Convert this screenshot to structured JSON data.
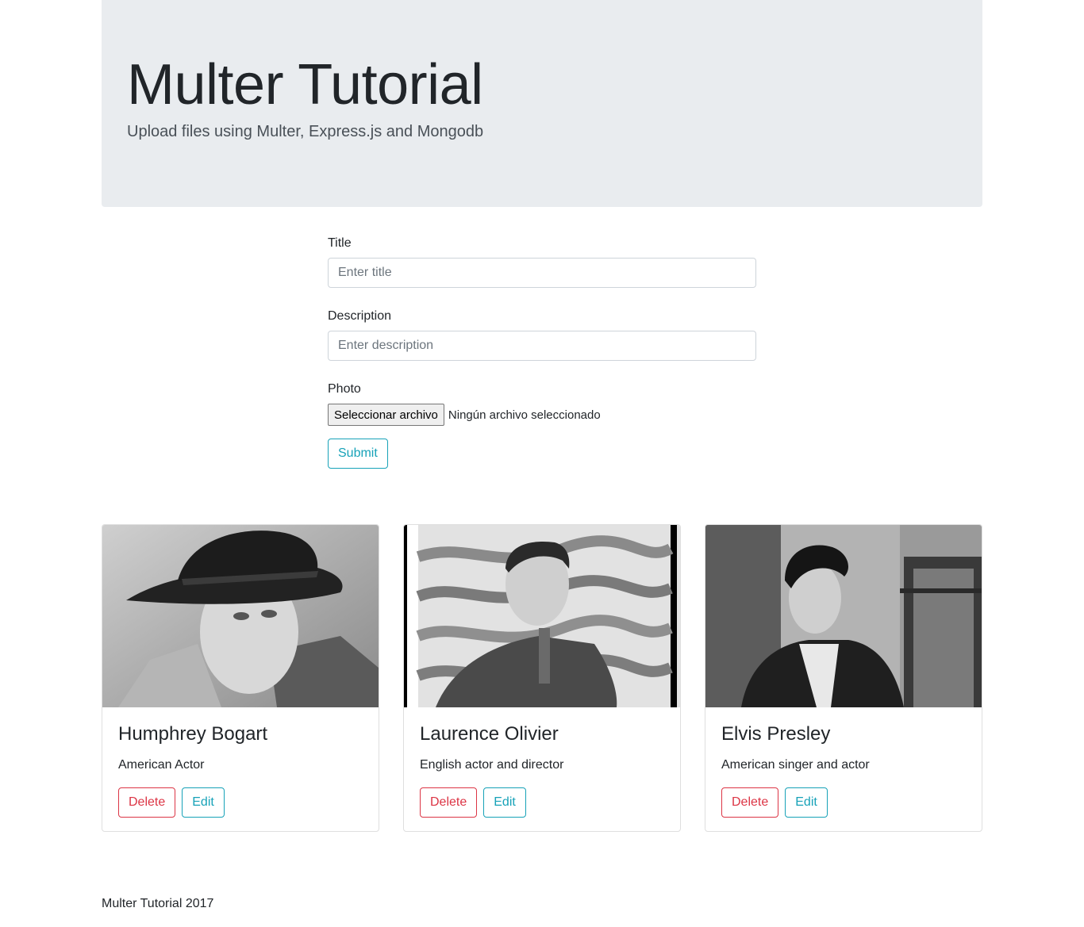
{
  "jumbotron": {
    "title": "Multer Tutorial",
    "subtitle": "Upload files using Multer, Express.js and Mongodb"
  },
  "form": {
    "title_label": "Title",
    "title_placeholder": "Enter title",
    "description_label": "Description",
    "description_placeholder": "Enter description",
    "photo_label": "Photo",
    "file_button": "Seleccionar archivo",
    "file_status": "Ningún archivo seleccionado",
    "submit_label": "Submit"
  },
  "cards": [
    {
      "name": "Humphrey Bogart",
      "description": "American Actor",
      "delete_label": "Delete",
      "edit_label": "Edit",
      "photo": "portrait-photo"
    },
    {
      "name": "Laurence Olivier",
      "description": "English actor and director",
      "delete_label": "Delete",
      "edit_label": "Edit",
      "photo": "portrait-photo"
    },
    {
      "name": "Elvis Presley",
      "description": "American singer and actor",
      "delete_label": "Delete",
      "edit_label": "Edit",
      "photo": "portrait-photo"
    }
  ],
  "footer": {
    "text": "Multer Tutorial 2017"
  },
  "colors": {
    "jumbotron_bg": "#e9ecef",
    "info": "#17a2b8",
    "danger": "#dc3545"
  }
}
